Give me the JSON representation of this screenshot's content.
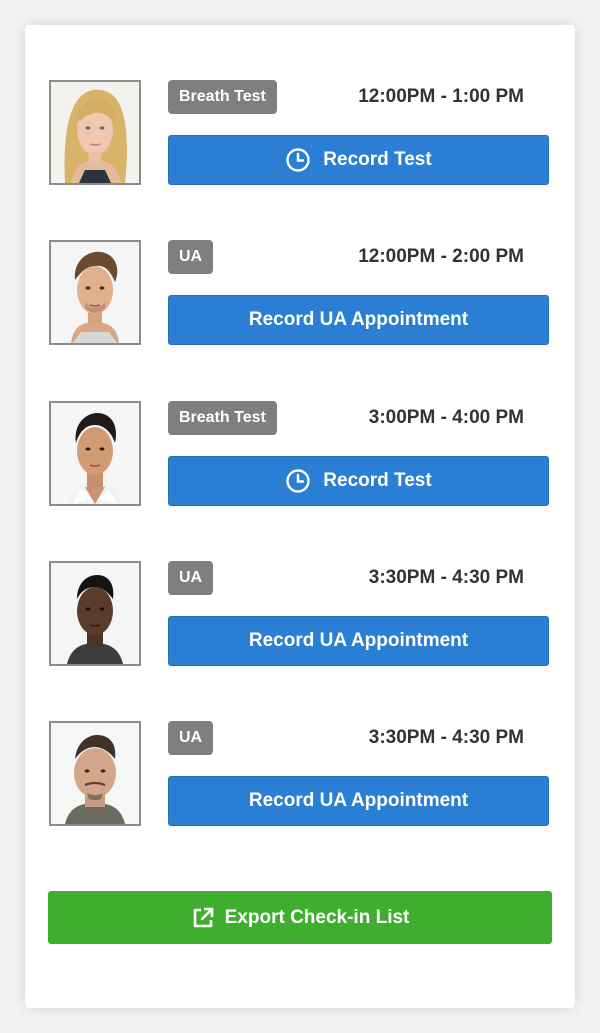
{
  "colors": {
    "badge_bg": "#7f7f7f",
    "action_blue": "#2a7fd4",
    "export_green": "#3fae2f",
    "time_text": "#333333"
  },
  "appointments": [
    {
      "type_badge": "Breath Test",
      "time": "12:00PM - 1:00 PM",
      "action_label": "Record Test",
      "action_icon": "clock-icon"
    },
    {
      "type_badge": "UA",
      "time": "12:00PM - 2:00 PM",
      "action_label": "Record UA Appointment",
      "action_icon": ""
    },
    {
      "type_badge": "Breath Test",
      "time": "3:00PM - 4:00 PM",
      "action_label": "Record Test",
      "action_icon": "clock-icon"
    },
    {
      "type_badge": "UA",
      "time": "3:30PM - 4:30 PM",
      "action_label": "Record UA Appointment",
      "action_icon": ""
    },
    {
      "type_badge": "UA",
      "time": "3:30PM - 4:30 PM",
      "action_label": "Record UA Appointment",
      "action_icon": ""
    }
  ],
  "footer": {
    "export_label": "Export Check-in List",
    "export_icon": "external-link-icon"
  }
}
